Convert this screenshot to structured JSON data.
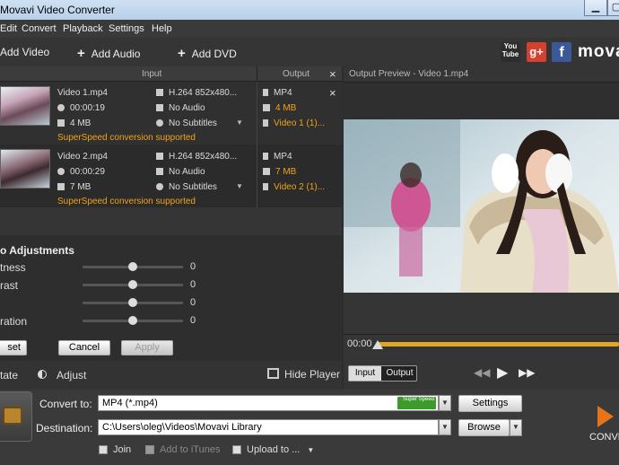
{
  "window": {
    "title": "Movavi Video Converter"
  },
  "menu": [
    "Edit",
    "Convert",
    "Playback",
    "Settings",
    "Help"
  ],
  "toolbar": {
    "add_video": "Add Video",
    "add_audio": "Add Audio",
    "add_dvd": "Add DVD",
    "youtube": "You Tube",
    "gplus": "g+",
    "facebook": "f",
    "brand": "movavi"
  },
  "list_header": {
    "input": "Input",
    "output": "Output",
    "close": "×"
  },
  "files": [
    {
      "name": "Video 1.mp4",
      "duration": "00:00:19",
      "size": "4 MB",
      "codec": "H.264 852x480...",
      "audio": "No Audio",
      "subtitles": "No Subtitles",
      "out_format": "MP4",
      "out_size": "4 MB",
      "out_name": "Video 1 (1)...",
      "superspeed": "SuperSpeed conversion supported"
    },
    {
      "name": "Video 2.mp4",
      "duration": "00:00:29",
      "size": "7 MB",
      "codec": "H.264 852x480...",
      "audio": "No Audio",
      "subtitles": "No Subtitles",
      "out_format": "MP4",
      "out_size": "7 MB",
      "out_name": "Video 2 (1)...",
      "superspeed": "SuperSpeed conversion supported"
    }
  ],
  "adjust": {
    "title": "o Adjustments",
    "brightness": "tness",
    "contrast": "rast",
    "blank": "",
    "saturation": "ration",
    "values": [
      "0",
      "0",
      "0",
      "0"
    ],
    "levels": [
      0.5,
      0.5,
      0.5,
      0.5
    ],
    "reset": "set",
    "cancel": "Cancel",
    "apply": "Apply"
  },
  "tools": {
    "rotate": "tate",
    "adjust": "Adjust",
    "hide_player": "Hide Player"
  },
  "preview": {
    "title": "Output Preview - Video 1.mp4",
    "time": "00:00",
    "input_tab": "Input",
    "output_tab": "Output"
  },
  "bottom": {
    "convert_to_label": "Convert to:",
    "format": "MP4 (*.mp4)",
    "superspeed_badge": "Super Speed",
    "settings": "Settings",
    "destination_label": "Destination:",
    "path": "C:\\Users\\oleg\\Videos\\Movavi Library",
    "browse": "Browse",
    "join": "Join",
    "itunes": "Add to iTunes",
    "upload": "Upload to ...",
    "convert": "CONVE"
  },
  "colors": {
    "accent": "#f0a31a",
    "superspeed_green": "#3f9a2e"
  }
}
